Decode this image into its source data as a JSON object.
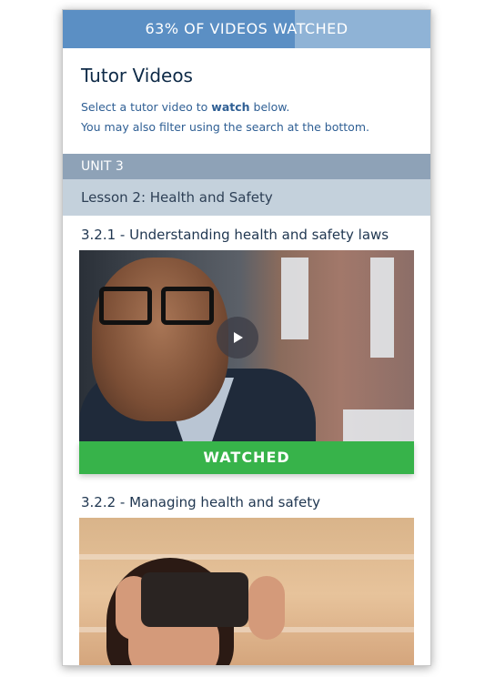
{
  "progress": {
    "label": "63% OF VIDEOS WATCHED",
    "percent": 63
  },
  "header": {
    "title": "Tutor Videos",
    "line1_before": "Select a tutor video to ",
    "line1_bold": "watch",
    "line1_after": " below.",
    "line2": "You may also filter using the search at the bottom."
  },
  "unit": {
    "label": "UNIT 3"
  },
  "lesson": {
    "label": "Lesson 2: Health and Safety"
  },
  "videos": [
    {
      "title": "3.2.1 - Understanding health and safety laws",
      "status": "WATCHED",
      "play_icon": "play-icon"
    },
    {
      "title": "3.2.2 - Managing health and safety"
    }
  ],
  "colors": {
    "progress_fill": "#5b8fc4",
    "progress_track": "#8fb3d6",
    "watched_green": "#37b34a",
    "unit_bar": "#8ea2b7",
    "lesson_bar": "#c4d1dc"
  }
}
